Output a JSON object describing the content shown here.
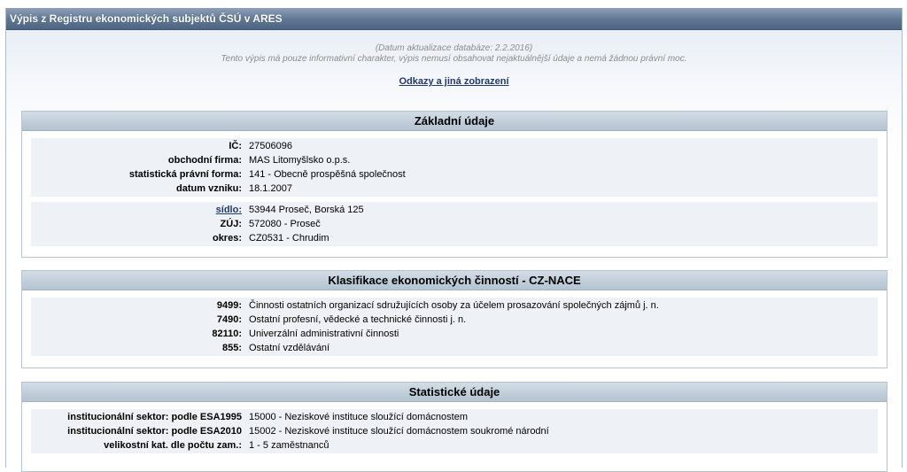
{
  "window": {
    "title": "Výpis z Registru ekonomických subjektů ČSÚ v ARES"
  },
  "meta": {
    "update_line": "(Datum aktualizace databáze: 2.2.2016)",
    "disclaimer": "Tento výpis má pouze informativní charakter, výpis nemusí obsahovat nejaktuálnější údaje a nemá žádnou právní moc.",
    "links_label": "Odkazy a jiná zobrazení"
  },
  "basic": {
    "header": "Základní údaje",
    "rows": [
      {
        "label": "IČ:",
        "value": "27506096"
      },
      {
        "label": "obchodní firma:",
        "value": "MAS Litomyšlsko o.p.s."
      },
      {
        "label": "statistická právní forma:",
        "value": "141 - Obecně prospěšná společnost"
      },
      {
        "label": "datum vzniku:",
        "value": "18.1.2007"
      }
    ],
    "address": [
      {
        "label": "sídlo:",
        "value": "53944 Proseč, Borská 125"
      },
      {
        "label": "ZÚJ:",
        "value": "572080 - Proseč"
      },
      {
        "label": "okres:",
        "value": "CZ0531 - Chrudim"
      }
    ]
  },
  "nace": {
    "header": "Klasifikace ekonomických činností - CZ-NACE",
    "rows": [
      {
        "label": "9499:",
        "value": "Činnosti ostatních organizací sdružujících osoby za účelem prosazování společných zájmů j. n."
      },
      {
        "label": "7490:",
        "value": "Ostatní profesní, vědecké a technické činnosti j. n."
      },
      {
        "label": "82110:",
        "value": "Univerzální administrativní činnosti"
      },
      {
        "label": "855:",
        "value": "Ostatní vzdělávání"
      }
    ]
  },
  "stats": {
    "header": "Statistické údaje",
    "rows": [
      {
        "label": "institucionální sektor: podle ESA1995",
        "value": "15000 - Neziskové instituce sloužící domácnostem"
      },
      {
        "label": "institucionální sektor: podle ESA2010",
        "value": "15002 - Neziskové instituce sloužící domácnostem soukromé národní"
      },
      {
        "label": "velikostní kat. dle počtu zam.:",
        "value": "1 - 5 zaměstnanců"
      }
    ]
  }
}
